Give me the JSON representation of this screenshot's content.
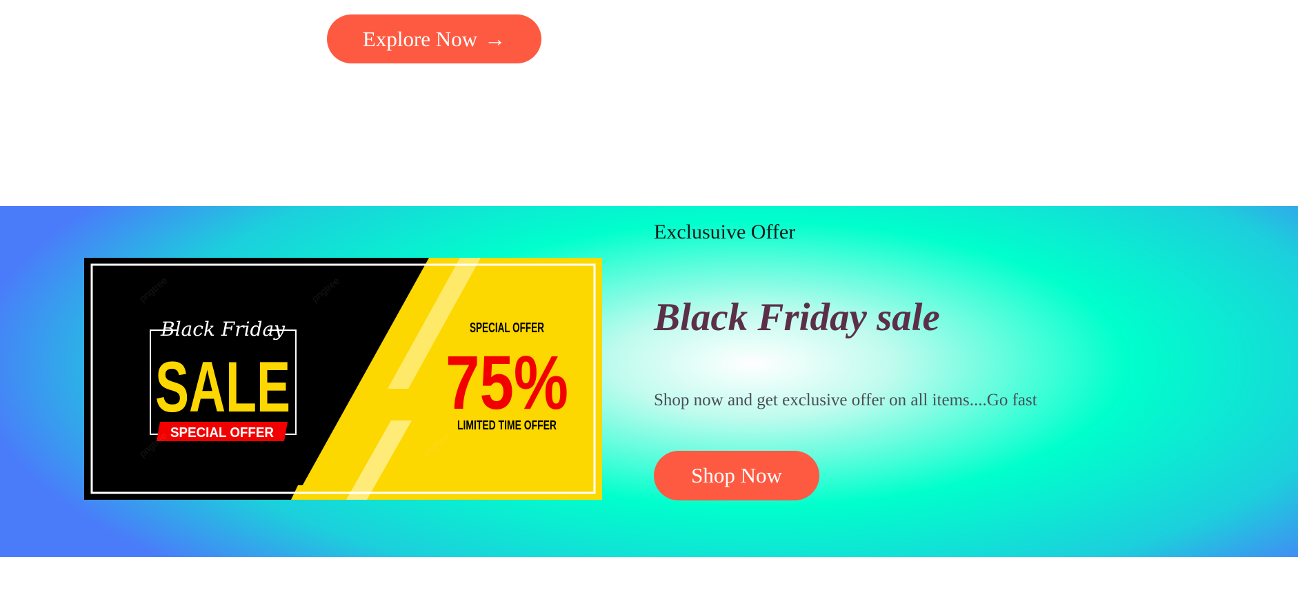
{
  "hero": {
    "explore_label": "Explore Now",
    "explore_arrow": "→"
  },
  "offer": {
    "label": "Exclusuive Offer",
    "heading": "Black Friday sale",
    "description": "Shop now and get exclusive offer on all items....Go fast",
    "shop_label": "Shop Now"
  },
  "banner": {
    "script_title": "Black Friday",
    "big_word": "SALE",
    "ribbon": "SPECIAL OFFER",
    "right_caption": "SPECIAL OFFER",
    "percent": "75%",
    "limited": "LIMITED TIME OFFER",
    "watermark": "pngtree"
  },
  "colors": {
    "accent": "#fe5a42",
    "heading": "#5b2f48",
    "banner_yellow": "#fdd700",
    "banner_red": "#f20000",
    "banner_black": "#000000"
  }
}
